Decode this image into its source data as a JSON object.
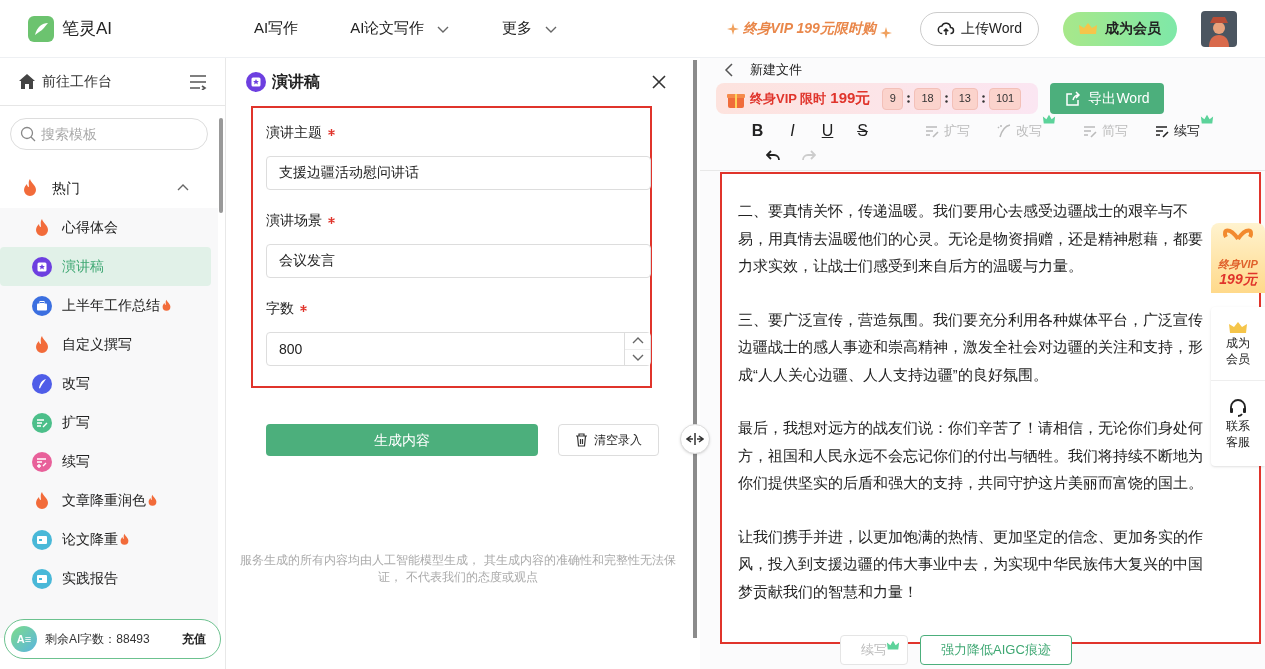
{
  "header": {
    "logo_text": "笔灵AI",
    "nav": [
      {
        "label": "AI写作",
        "dropdown": false
      },
      {
        "label": "AI论文写作",
        "dropdown": true
      },
      {
        "label": "更多",
        "dropdown": true
      }
    ],
    "promo": "终身VIP 199元限时购",
    "upload_button": "上传Word",
    "member_button": "成为会员"
  },
  "sidebar": {
    "workbench": "前往工作台",
    "search": {
      "placeholder": "搜索模板"
    },
    "group": {
      "label": "热门",
      "expanded": true,
      "items": [
        {
          "label": "心得体会",
          "kind": "flame",
          "hot": false,
          "selected": false
        },
        {
          "label": "演讲稿",
          "kind": "star",
          "hot": false,
          "selected": true
        },
        {
          "label": "上半年工作总结",
          "kind": "briefcase",
          "hot": true,
          "selected": false
        },
        {
          "label": "自定义撰写",
          "kind": "flame",
          "hot": false,
          "selected": false
        },
        {
          "label": "改写",
          "kind": "quill",
          "hot": false,
          "selected": false
        },
        {
          "label": "扩写",
          "kind": "expand",
          "hot": false,
          "selected": false
        },
        {
          "label": "续写",
          "kind": "continue",
          "hot": false,
          "selected": false
        },
        {
          "label": "文章降重润色",
          "kind": "flame",
          "hot": true,
          "selected": false
        },
        {
          "label": "论文降重",
          "kind": "card",
          "hot": true,
          "selected": false
        },
        {
          "label": "实践报告",
          "kind": "card",
          "hot": false,
          "selected": false
        }
      ]
    },
    "credits": {
      "avatar": "A≡",
      "label": "剩余AI字数：88493",
      "action": "充值"
    }
  },
  "form": {
    "title": "演讲稿",
    "fields": [
      {
        "kind": "text",
        "label": "演讲主题",
        "required": true,
        "value": "支援边疆活动慰问讲话"
      },
      {
        "kind": "text",
        "label": "演讲场景",
        "required": true,
        "value": "会议发言"
      },
      {
        "kind": "number",
        "label": "字数",
        "required": true,
        "value": "800"
      }
    ],
    "generate_button": "生成内容",
    "clear_button": "清空录入",
    "disclaimer": "服务生成的所有内容均由人工智能模型生成， 其生成内容的准确性和完整性无法保证， 不代表我们的态度或观点"
  },
  "editor": {
    "title": "新建文件",
    "promo": {
      "label": "终身VIP 限时",
      "price": "199元",
      "countdown": [
        "9",
        "18",
        "13",
        "101"
      ]
    },
    "export_button": "导出Word",
    "format": [
      {
        "kind": "bold",
        "label": "B"
      },
      {
        "kind": "italic",
        "label": "I"
      },
      {
        "kind": "underline",
        "label": "U"
      },
      {
        "kind": "strike",
        "label": "S"
      }
    ],
    "tools": [
      {
        "label": "扩写",
        "kind": "expand",
        "enabled": false,
        "premium": false
      },
      {
        "label": "改写",
        "kind": "quill",
        "enabled": false,
        "premium": true
      },
      {
        "label": "简写",
        "kind": "shorten",
        "enabled": false,
        "premium": false
      },
      {
        "label": "续写",
        "kind": "continue",
        "enabled": true,
        "premium": true
      }
    ],
    "undo_enabled": true,
    "redo_enabled": false,
    "paragraphs": [
      "二、要真情关怀，传递温暖。我们要用心去感受边疆战士的艰辛与不易，用真情去温暖他们的心灵。无论是物资捐赠，还是精神慰藉，都要力求实效，让战士们感受到来自后方的温暖与力量。",
      "三、要广泛宣传，营造氛围。我们要充分利用各种媒体平台，广泛宣传边疆战士的感人事迹和崇高精神，激发全社会对边疆的关注和支持，形成“人人关心边疆、人人支持边疆”的良好氛围。",
      "最后，我想对远方的战友们说：你们辛苦了！请相信，无论你们身处何方，祖国和人民永远不会忘记你们的付出与牺牲。我们将持续不断地为你们提供坚实的后盾和强大的支持，共同守护这片美丽而富饶的国土。",
      "让我们携手并进，以更加饱满的热情、更加坚定的信念、更加务实的作风，投入到支援边疆的伟大事业中去，为实现中华民族伟大复兴的中国梦贡献我们的智慧和力量！"
    ],
    "float_actions": [
      {
        "label": "续写",
        "enabled": false,
        "premium": true
      },
      {
        "label": "强力降低AIGC痕迹",
        "enabled": true,
        "premium": false
      }
    ],
    "side_widgets": {
      "vip": [
        "终身VIP",
        "199元"
      ],
      "member": "成为会员",
      "service": "联系客服"
    }
  }
}
